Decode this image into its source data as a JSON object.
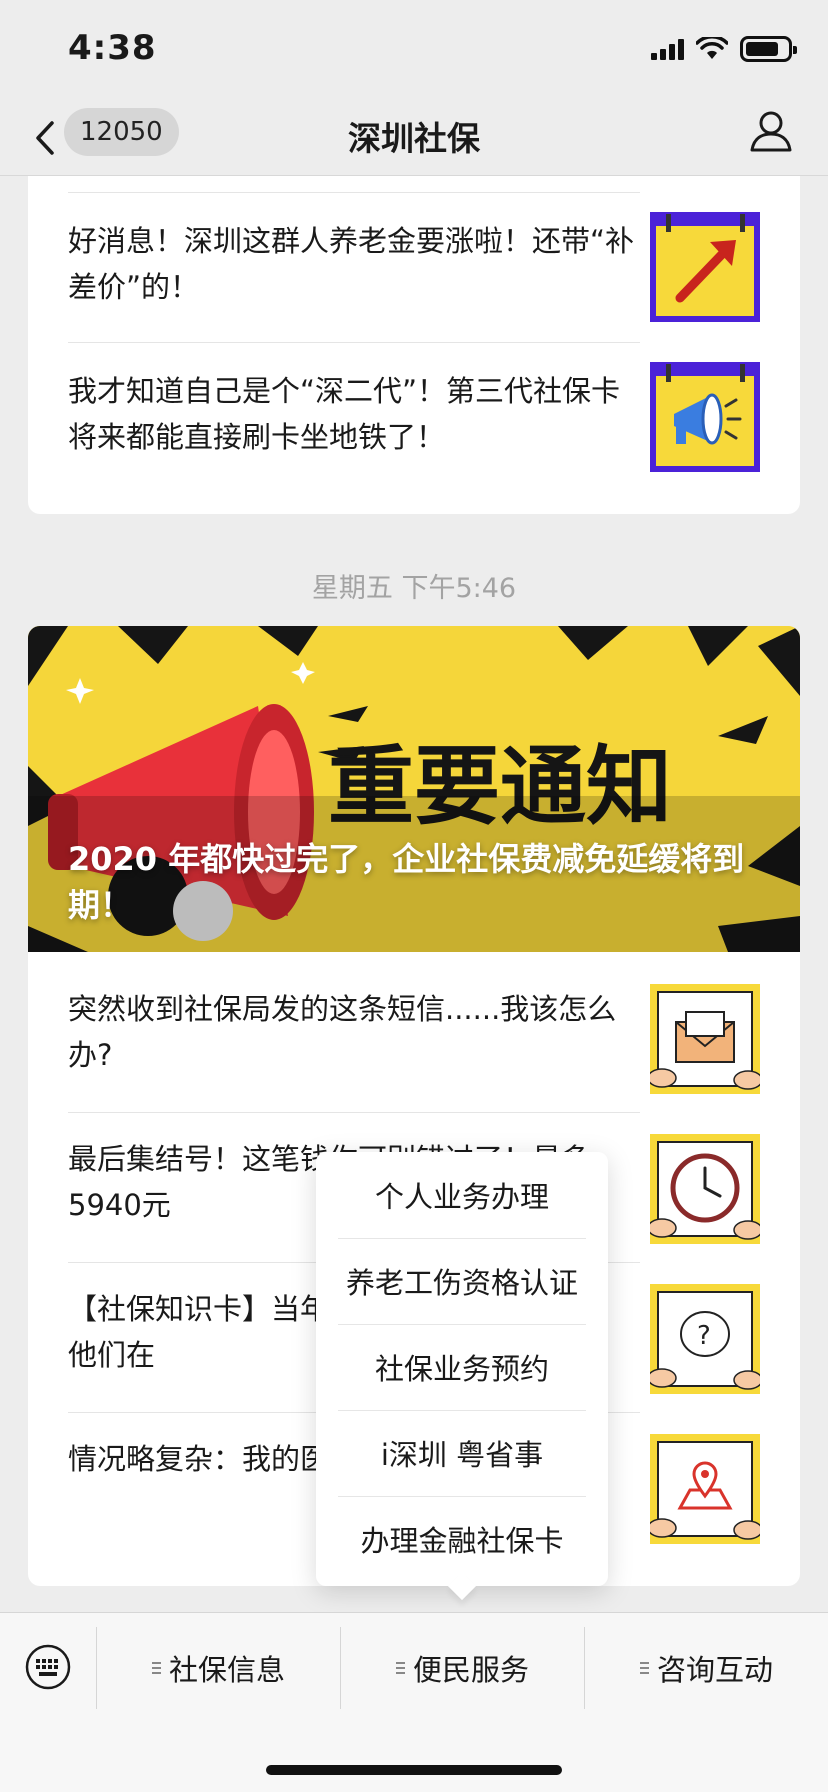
{
  "status_bar": {
    "time": "4:38",
    "battery_level": 0.8
  },
  "nav": {
    "unread_count": "12050",
    "title": "深圳社保",
    "icons": [
      "back-chevron-icon",
      "profile-icon"
    ]
  },
  "articles_top": [
    {
      "title": "好消息！深圳这群人养老金要涨啦！还带“补差价”的！",
      "thumb": "arrow-up-thumbnail"
    },
    {
      "title": "我才知道自己是个“深二代”！第三代社保卡将来都能直接刷卡坐地铁了！",
      "thumb": "megaphone-thumbnail"
    }
  ],
  "timestamp": "星期五 下午5:46",
  "banner": {
    "headline_art": "重要通知",
    "caption": "2020 年都快过完了，企业社保费减免延缓将到期！"
  },
  "articles_bottom": [
    {
      "title": "突然收到社保局发的这条短信......我该怎么办?",
      "thumb": "envelope-thumbnail"
    },
    {
      "title": "最后集结号！这笔钱你可别错过了！最多5940元",
      "thumb": "clock-thumbnail"
    },
    {
      "title": "【社保知识卡】当年的“视同缴费前工龄”，他们在",
      "thumb": "question-thumbnail"
    },
    {
      "title": "情况略复杂：我的医保缴费地在哪儿?",
      "thumb": "map-pin-thumbnail"
    }
  ],
  "popup_menu": {
    "items": [
      "个人业务办理",
      "养老工伤资格认证",
      "社保业务预约",
      "i深圳 粤省事",
      "办理金融社保卡"
    ]
  },
  "bottom_menu": {
    "items": [
      "社保信息",
      "便民服务",
      "咨询互动"
    ]
  },
  "colors": {
    "banner_yellow": "#f5d63a",
    "thumb_yellow": "#f7d93a",
    "thumb_purple": "#4b22d8",
    "megaphone_red": "#e8313a"
  }
}
